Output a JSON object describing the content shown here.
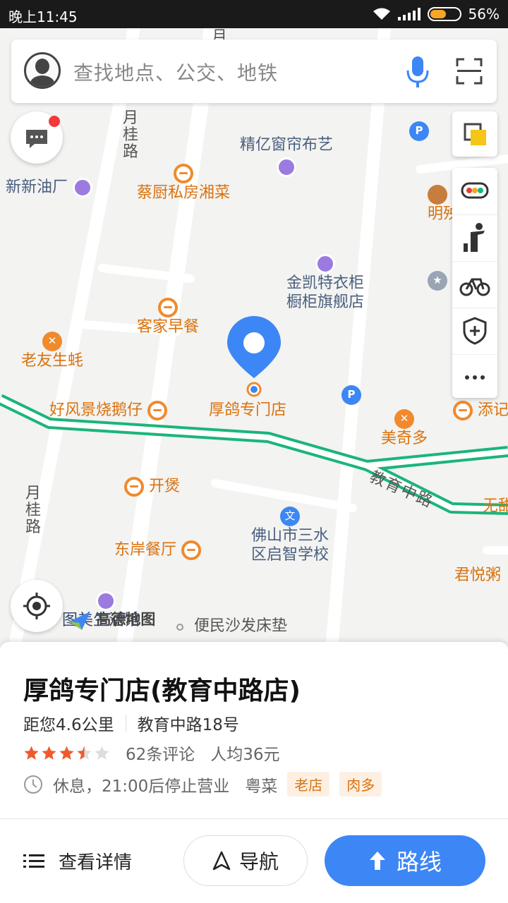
{
  "status_bar": {
    "time": "晚上11:45",
    "battery": "56%",
    "battery_level": 0.56
  },
  "search": {
    "placeholder": "查找地点、公交、地铁"
  },
  "map": {
    "road_labels": [
      "月桂路",
      "月桂路",
      "教育中路",
      "月"
    ],
    "pois": {
      "jingyi": "精亿窗帘布艺",
      "xinxin": "新新油厂",
      "caichu": "蔡厨私房湘菜",
      "mingfa": "明殃",
      "jinkai_1": "金凯特衣柜",
      "jinkai_2": "橱柜旗舰店",
      "kejia": "客家早餐",
      "laoyou": "老友生蚝",
      "haofeng": "好风景烧鹅仔",
      "target": "厚鸽专门店",
      "tianji": "添记",
      "meiqiduo": "美奇多",
      "kaibao": "开煲",
      "dongan": "东岸餐厅",
      "school_1": "佛山市三水",
      "school_2": "区启智学校",
      "junyue": "君悦粥",
      "wuzhi": "无甜",
      "bianmin": "便民沙发床垫",
      "tumei": "图美生活馆"
    },
    "logo_text": "高德地图"
  },
  "place": {
    "title": "厚鸽专门店(教育中路店)",
    "distance": "距您4.6公里",
    "address": "教育中路18号",
    "rating": 3.5,
    "reviews": "62条评论",
    "avg_price": "人均36元",
    "hours": "休息，21:00后停止营业",
    "category": "粤菜",
    "tags": [
      "老店",
      "肉多"
    ]
  },
  "actions": {
    "detail": "查看详情",
    "navigate": "导航",
    "route": "路线"
  },
  "colors": {
    "accent": "#3d86f5",
    "poi_orange": "#d9720f",
    "route_green": "#1bb57a"
  }
}
